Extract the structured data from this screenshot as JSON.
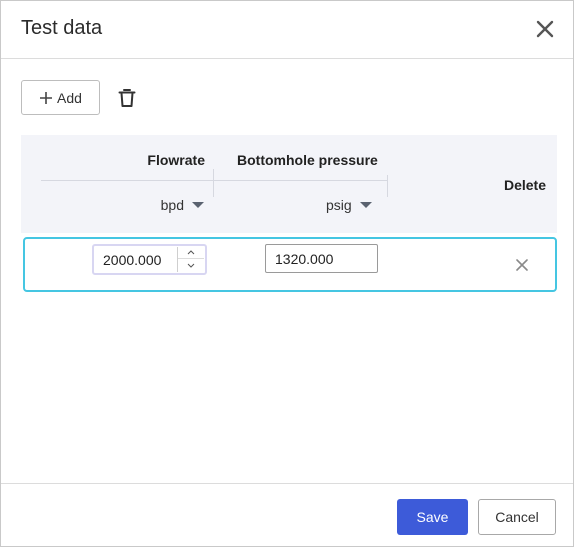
{
  "dialog": {
    "title": "Test data",
    "close_icon": "close-icon"
  },
  "toolbar": {
    "add_label": "Add",
    "add_icon": "plus-icon",
    "delete_icon": "trash-icon"
  },
  "table": {
    "columns": [
      {
        "title": "Flowrate",
        "unit": "bpd"
      },
      {
        "title": "Bottomhole pressure",
        "unit": "psig"
      },
      {
        "title": "Delete"
      }
    ],
    "rows": [
      {
        "flowrate": "2000.000",
        "bottomhole_pressure": "1320.000"
      }
    ]
  },
  "footer": {
    "save_label": "Save",
    "cancel_label": "Cancel"
  },
  "colors": {
    "accent": "#3d5bd9",
    "row_highlight": "#45c6e2",
    "header_bg": "#f3f4f9"
  }
}
